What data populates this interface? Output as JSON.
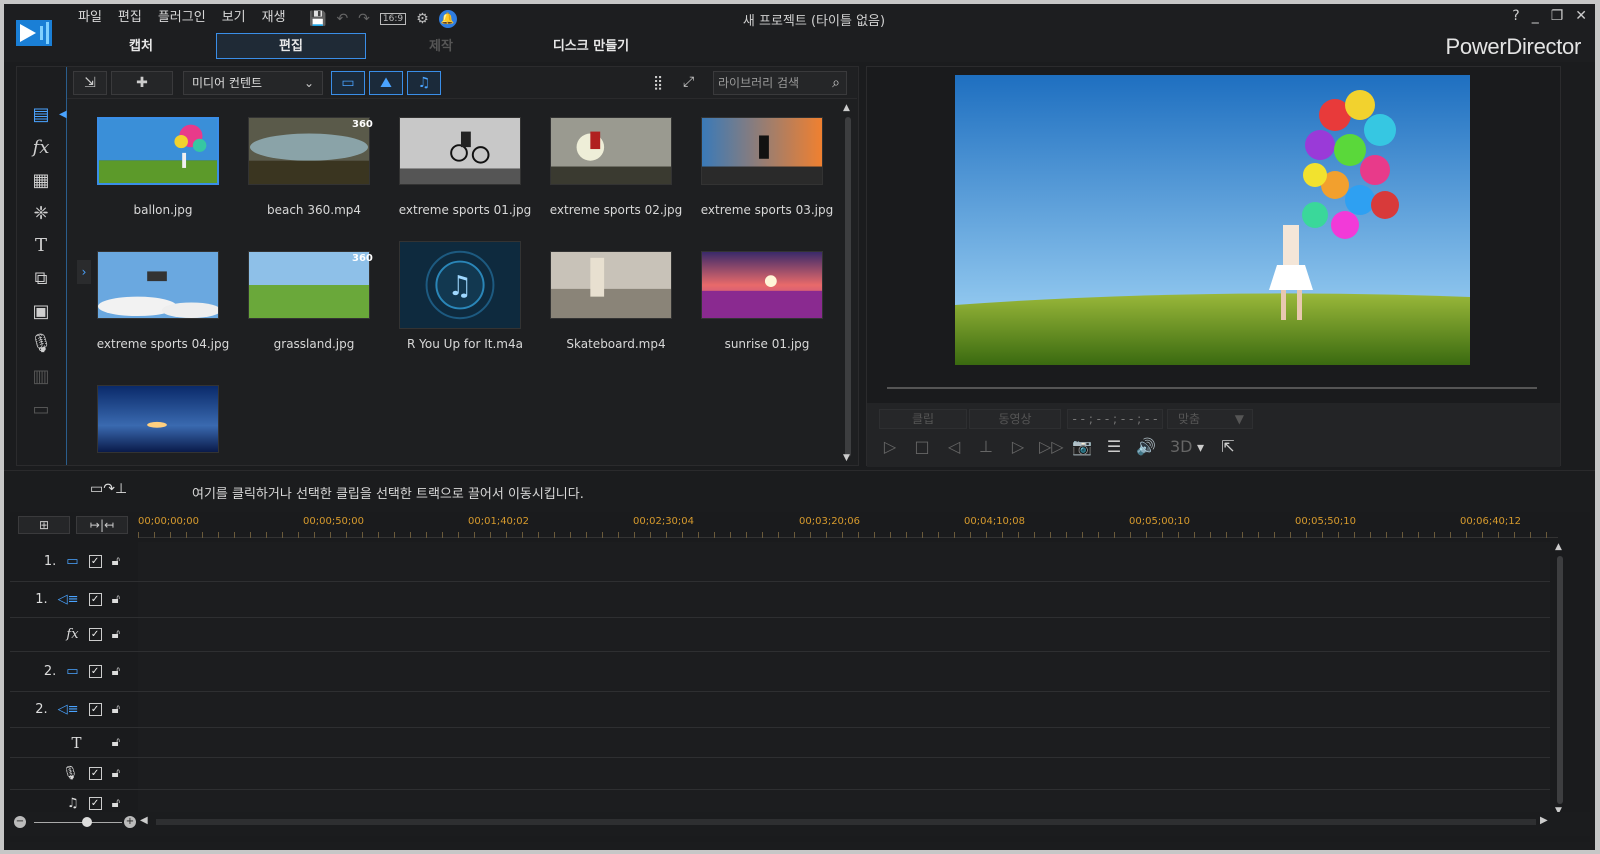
{
  "app": {
    "window_title": "새 프로젝트 (타이틀 없음)",
    "brand": "PowerDirector",
    "menu": [
      "파일",
      "편집",
      "플러그인",
      "보기",
      "재생"
    ],
    "aspect": "16:9",
    "modes": [
      {
        "label": "캡처",
        "state": "normal"
      },
      {
        "label": "편집",
        "state": "active"
      },
      {
        "label": "제작",
        "state": "disabled"
      },
      {
        "label": "디스크 만들기",
        "state": "normal"
      }
    ],
    "window_buttons": [
      "?",
      "_",
      "❐",
      "✕"
    ]
  },
  "library": {
    "dropdown": "미디어 컨텐트",
    "search_placeholder": "라이브러리 검색",
    "items": [
      {
        "name": "ballon.jpg",
        "selected": true,
        "badge": ""
      },
      {
        "name": "beach 360.mp4",
        "selected": false,
        "badge": "360"
      },
      {
        "name": "extreme sports 01.jpg",
        "selected": false,
        "badge": ""
      },
      {
        "name": "extreme sports 02.jpg",
        "selected": false,
        "badge": ""
      },
      {
        "name": "extreme sports 03.jpg",
        "selected": false,
        "badge": ""
      },
      {
        "name": "extreme sports 04.jpg",
        "selected": false,
        "badge": ""
      },
      {
        "name": "grassland.jpg",
        "selected": false,
        "badge": "360"
      },
      {
        "name": "R You Up for It.m4a",
        "selected": false,
        "badge": ""
      },
      {
        "name": "Skateboard.mp4",
        "selected": false,
        "badge": ""
      },
      {
        "name": "sunrise 01.jpg",
        "selected": false,
        "badge": ""
      },
      {
        "name": "",
        "selected": false,
        "badge": ""
      }
    ]
  },
  "preview": {
    "clip_label": "클립",
    "movie_label": "동영상",
    "timecode": "- - ; - - ; - - ; - -",
    "fit_label": "맞춤",
    "mode_3d": "3D"
  },
  "instruction": "여기를 클릭하거나 선택한 클립을 선택한 트랙으로 끌어서 이동시킵니다.",
  "timeline": {
    "ticks": [
      "00;00;00;00",
      "00;00;50;00",
      "00;01;40;02",
      "00;02;30;04",
      "00;03;20;06",
      "00;04;10;08",
      "00;05;00;10",
      "00;05;50;10",
      "00;06;40;12"
    ],
    "tracks": [
      {
        "num": "1.",
        "type": "video",
        "checked": true
      },
      {
        "num": "1.",
        "type": "audio",
        "checked": true
      },
      {
        "num": "",
        "type": "fx",
        "checked": true
      },
      {
        "num": "2.",
        "type": "video",
        "checked": true
      },
      {
        "num": "2.",
        "type": "audio",
        "checked": true
      },
      {
        "num": "",
        "type": "title",
        "checked": false
      },
      {
        "num": "",
        "type": "voice",
        "checked": true
      },
      {
        "num": "",
        "type": "music",
        "checked": true
      }
    ]
  }
}
